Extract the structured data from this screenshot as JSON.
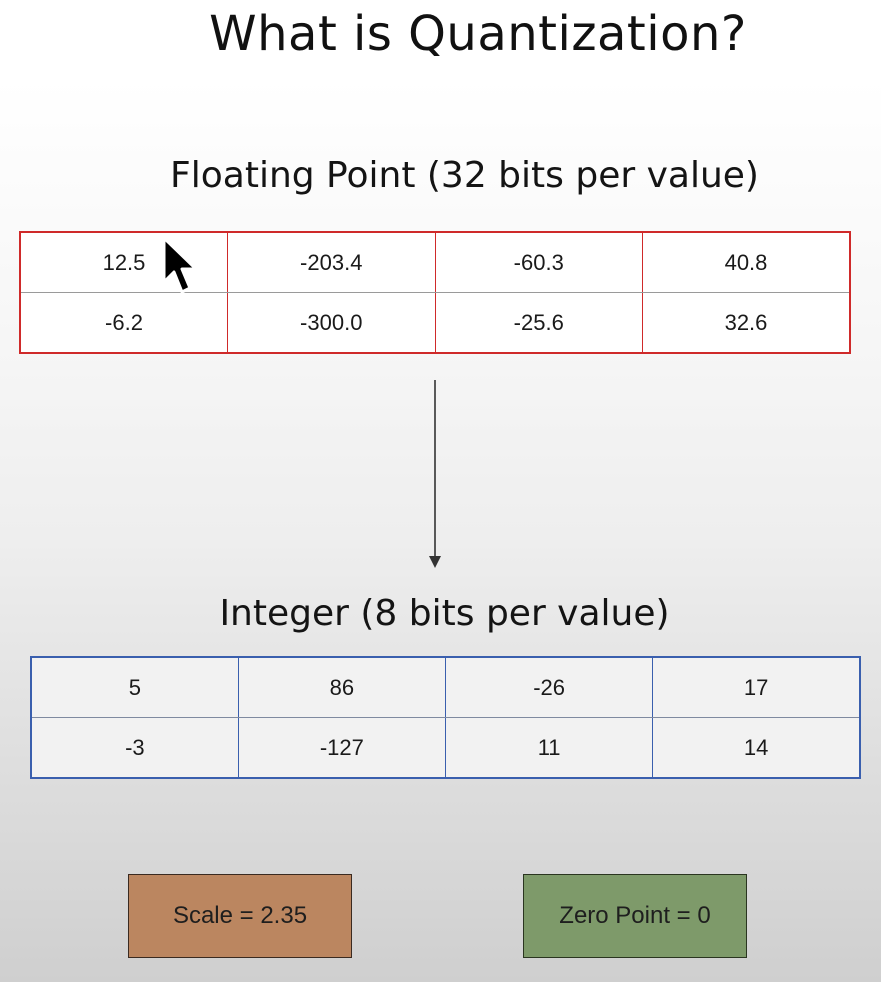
{
  "title": "What is Quantization?",
  "float_section": {
    "heading": "Floating Point (32 bits per value)",
    "rows": [
      [
        "12.5",
        "-203.4",
        "-60.3",
        "40.8"
      ],
      [
        "-6.2",
        "-300.0",
        "-25.6",
        "32.6"
      ]
    ],
    "border_color": "#cf2a2a"
  },
  "int_section": {
    "heading": "Integer (8 bits per value)",
    "rows": [
      [
        "5",
        "86",
        "-26",
        "17"
      ],
      [
        "-3",
        "-127",
        "11",
        "14"
      ]
    ],
    "border_color": "#3a5fae"
  },
  "params": {
    "scale_label": "Scale = 2.35",
    "scale_color": "#bb8660",
    "zero_point_label": "Zero Point = 0",
    "zero_point_color": "#7e9a6a"
  },
  "icons": {
    "arrow": "arrow-down-icon",
    "cursor": "mouse-cursor-icon"
  }
}
